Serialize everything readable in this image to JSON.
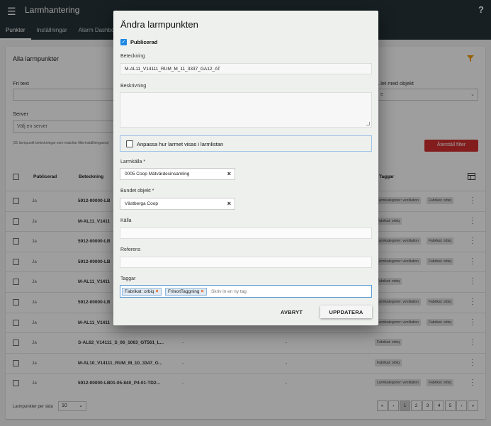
{
  "appbar": {
    "title": "Larmhantering",
    "help": "?"
  },
  "tabs": [
    {
      "label": "Punkter"
    },
    {
      "label": "Inställningar"
    },
    {
      "label": "Alarm Dashboard"
    }
  ],
  "list": {
    "card_title": "Alla larmpunkter",
    "free_text_label": "Fri text",
    "server_label": "Server",
    "server_placeholder": "Välj en server",
    "linked_object_label": "...let med objekt",
    "linked_object_value": "e",
    "hint": "(31 larmpunkt beteckningar som matchar filterinställningarna)",
    "reset_label": "Återställ filter",
    "headers": {
      "published": "Publicerad",
      "designation": "Beteckning",
      "tags": "Taggar"
    },
    "rows": [
      {
        "pub": "Ja",
        "bet": "5912-00000-LB",
        "tags": [
          "Larmkategorier: ventilation",
          "Fabrikat: orbiq"
        ]
      },
      {
        "pub": "Ja",
        "bet": "M-AL11_V1411",
        "tags": [
          "Fabrikat: orbiq"
        ]
      },
      {
        "pub": "Ja",
        "bet": "5912-00000-LB",
        "tags": [
          "Larmkategorier: ventilation",
          "Fabrikat: orbiq"
        ]
      },
      {
        "pub": "Ja",
        "bet": "5912-00000-LB",
        "tags": [
          "Larmkategorier: ventilation",
          "Fabrikat: orbiq"
        ]
      },
      {
        "pub": "Ja",
        "bet": "M-AL11_V1411",
        "tags": [
          "Fabrikat: orbiq"
        ]
      },
      {
        "pub": "Ja",
        "bet": "5912-00000-LB",
        "tags": [
          "Larmkategorier: ventilation",
          "Fabrikat: orbiq"
        ]
      },
      {
        "pub": "Ja",
        "bet": "M-AL11_V1411",
        "tags": [
          "Larmkategorier: ventilation",
          "Fabrikat: orbiq"
        ]
      },
      {
        "pub": "Ja",
        "bet": "S-AL62_V14111_S_06_1063_GT561_L...",
        "dash1": "-",
        "dash2": "-",
        "tags": [
          "Fabrikat: orbiq"
        ]
      },
      {
        "pub": "Ja",
        "bet": "M-AL10_V14111_RUM_M_10_3347_G...",
        "dash1": "-",
        "dash2": "-",
        "tags": [
          "Fabrikat: orbiq"
        ]
      },
      {
        "pub": "Ja",
        "bet": "5912-00000-LB01-05-840_P4-01-TD2...",
        "dash1": "-",
        "dash2": "-",
        "tags": [
          "Larmkategorier: ventilation",
          "Fabrikat: orbiq"
        ]
      }
    ],
    "per_page_label": "Larmpunkter per sida",
    "per_page_value": "10",
    "pager": [
      "«",
      "‹",
      "1",
      "2",
      "3",
      "4",
      "5",
      "›",
      "»"
    ],
    "pager_active": "1"
  },
  "dialog": {
    "title": "Ändra larmpunkten",
    "published_label": "Publicerad",
    "published_checked": true,
    "designation_label": "Beteckning",
    "designation_value": "M-AL11_V14111_RUM_M_11_3337_GA12_AT",
    "description_label": "Beskrivning",
    "description_value": "",
    "customize_label": "Anpassa hur larmet visas i larmlistan",
    "alarm_source_label": "Larmkälla *",
    "alarm_source_value": "0005 Coop Mätvärdesinsamling",
    "bound_object_label": "Bundet objekt *",
    "bound_object_value": "Västberga Coop",
    "source_label": "Källa",
    "source_value": "",
    "reference_label": "Referens",
    "reference_value": "",
    "tags_label": "Taggar",
    "tags": [
      "Fabrikat: orbiq",
      "FritextTaggning"
    ],
    "tag_placeholder": "Skriv in en ny tag",
    "cancel_label": "AVBRYT",
    "update_label": "UPPDATERA"
  },
  "colors": {
    "appbar": "#263238",
    "reset": "#d32f2f",
    "checkbox": "#1e88e5",
    "filter_icon": "#f29900"
  }
}
